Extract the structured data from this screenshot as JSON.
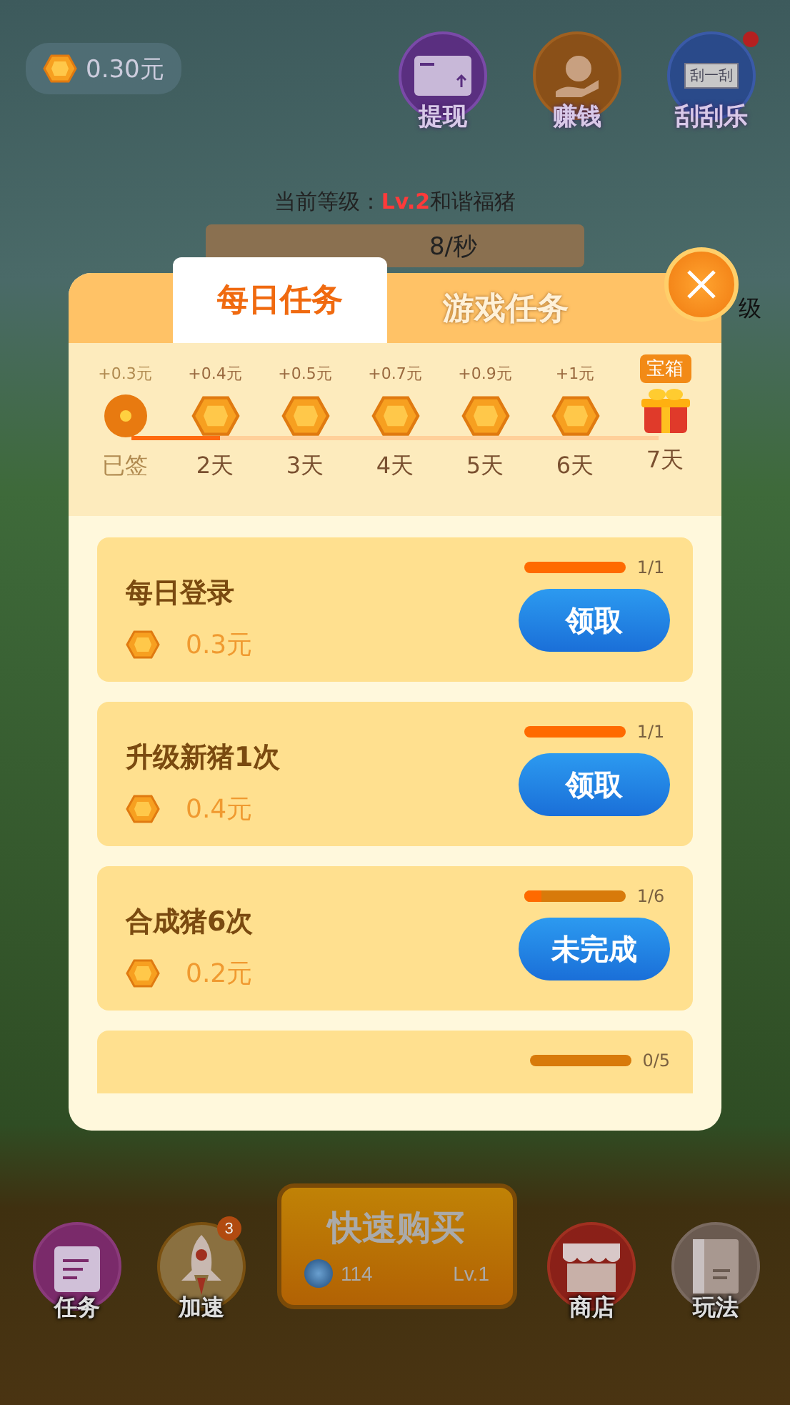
{
  "wallet": {
    "balance": "0.30元"
  },
  "top_actions": [
    {
      "label": "提现",
      "kind": "withdraw"
    },
    {
      "label": "赚钱",
      "kind": "earn"
    },
    {
      "label": "刮刮乐",
      "kind": "scratch",
      "ticket_text": "刮一刮",
      "alert": true
    }
  ],
  "level_info": {
    "label": "当前等级：",
    "level": "Lv.2",
    "name": "和谐福猪"
  },
  "stats": {
    "rate": "8/秒"
  },
  "side_text": "级",
  "modal": {
    "tabs": [
      {
        "label": "每日任务",
        "selected": true
      },
      {
        "label": "游戏任务",
        "selected": false
      }
    ],
    "checkin": [
      {
        "reward": "+0.3元",
        "day": "已签",
        "signed": true,
        "kind": "coin"
      },
      {
        "reward": "+0.4元",
        "day": "2天",
        "signed": false,
        "kind": "coin"
      },
      {
        "reward": "+0.5元",
        "day": "3天",
        "signed": false,
        "kind": "coin"
      },
      {
        "reward": "+0.7元",
        "day": "4天",
        "signed": false,
        "kind": "coin"
      },
      {
        "reward": "+0.9元",
        "day": "5天",
        "signed": false,
        "kind": "coin"
      },
      {
        "reward": "+1元",
        "day": "6天",
        "signed": false,
        "kind": "coin"
      },
      {
        "reward": "宝箱",
        "day": "7天",
        "signed": false,
        "kind": "chest"
      }
    ],
    "tasks": [
      {
        "title": "每日登录",
        "reward": "0.3元",
        "level": 1,
        "progress": "1/1",
        "action": "领取"
      },
      {
        "title": "升级新猪1次",
        "reward": "0.4元",
        "level": 1,
        "progress": "1/1",
        "action": "领取"
      },
      {
        "title": "合成猪6次",
        "reward": "0.2元",
        "level": 0.17,
        "progress": "1/6",
        "action": "未完成"
      },
      {
        "level": 0,
        "progress": "0/5"
      }
    ]
  },
  "bottom_nav": [
    {
      "label": "任务",
      "kind": "tasks"
    },
    {
      "label": "加速",
      "kind": "boost",
      "badge": "3"
    },
    {
      "label": "商店",
      "kind": "shop"
    },
    {
      "label": "玩法",
      "kind": "guide"
    }
  ],
  "quick_buy": {
    "title": "快速购买",
    "cost": "114",
    "level": "Lv.1"
  }
}
